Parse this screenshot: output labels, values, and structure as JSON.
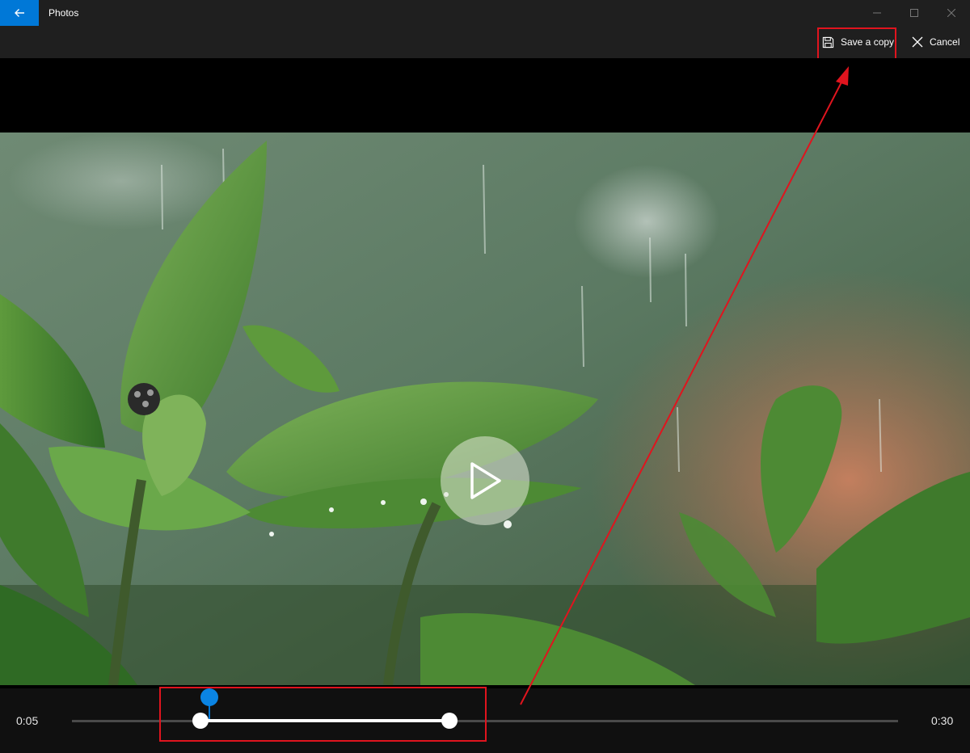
{
  "titlebar": {
    "app_title": "Photos"
  },
  "toolbar": {
    "save_label": "Save a copy",
    "cancel_label": "Cancel"
  },
  "timeline": {
    "start_time": "0:05",
    "end_time": "0:30"
  },
  "colors": {
    "accent": "#0078d7",
    "highlight": "#e0141e",
    "background": "#000000"
  },
  "icons": {
    "back": "back-arrow-icon",
    "save": "save-disk-icon",
    "cancel": "close-icon",
    "play": "play-icon",
    "minimize": "minimize-icon",
    "maximize": "maximize-icon",
    "close": "close-window-icon"
  }
}
